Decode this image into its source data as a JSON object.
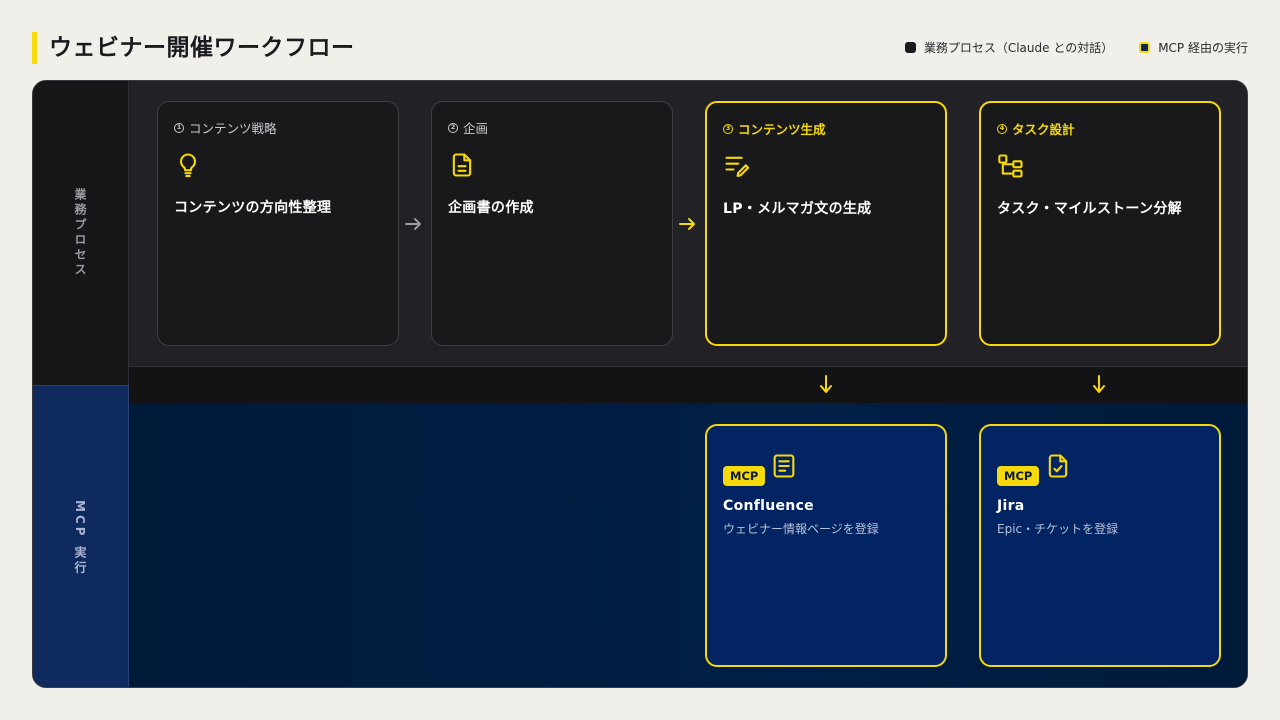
{
  "title": "ウェビナー開催ワークフロー",
  "legend": {
    "business": "業務プロセス（Claude との対話）",
    "mcp": "MCP 経由の実行"
  },
  "lanes": {
    "business": "業務プロセス",
    "mcp": "MCP 実行"
  },
  "steps": [
    {
      "num": "1",
      "label": "コンテンツ戦略",
      "title": "コンテンツの方向性整理",
      "icon": "lightbulb-icon"
    },
    {
      "num": "2",
      "label": "企画",
      "title": "企画書の作成",
      "icon": "document-icon"
    },
    {
      "num": "3",
      "label": "コンテンツ生成",
      "title": "LP・メルマガ文の生成",
      "icon": "edit-lines-icon"
    },
    {
      "num": "4",
      "label": "タスク設計",
      "title": "タスク・マイルストーン分解",
      "icon": "hierarchy-icon"
    }
  ],
  "mcp_cards": [
    {
      "badge": "MCP",
      "title": "Confluence",
      "desc": "ウェビナー情報ページを登録",
      "icon": "page-icon"
    },
    {
      "badge": "MCP",
      "title": "Jira",
      "desc": "Epic・チケットを登録",
      "icon": "ticket-check-icon"
    }
  ],
  "colors": {
    "accent": "#f5d90a",
    "business_bg": "#222226",
    "mcp_bg": "#011e46",
    "card_bg": "#19191c",
    "mcp_card_bg": "#022462"
  }
}
